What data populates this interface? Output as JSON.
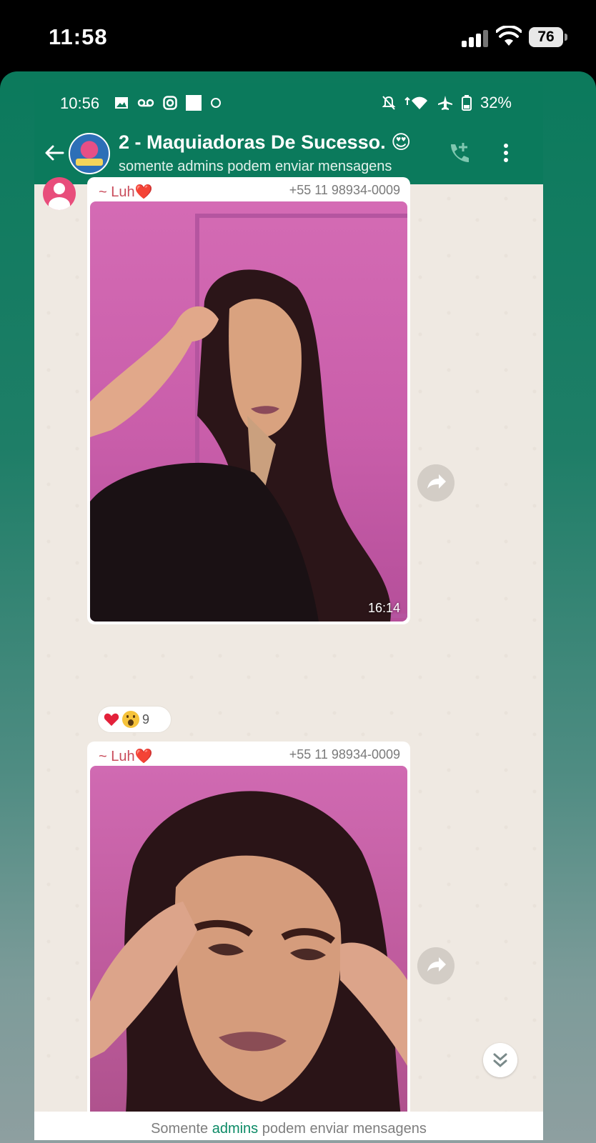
{
  "ios_status": {
    "time": "11:58",
    "battery": "76"
  },
  "android_status": {
    "time": "10:56",
    "battery": "32%"
  },
  "header": {
    "title": "2 - Maquiadoras De Sucesso. 😍",
    "subtitle": "somente admins podem enviar mensagens"
  },
  "messages": [
    {
      "sender": "~ Luh❤️",
      "phone": "+55 11 98934-0009",
      "time": "16:14"
    },
    {
      "sender": "~ Luh❤️",
      "phone": "+55 11 98934-0009"
    }
  ],
  "reactions": {
    "count": "9"
  },
  "footer": {
    "prefix": "Somente ",
    "link": "admins",
    "suffix": " podem enviar mensagens"
  },
  "colors": {
    "brand_green": "#0b7a5c",
    "sender_name": "#c94c5b",
    "chat_bg": "#efe9e2"
  }
}
